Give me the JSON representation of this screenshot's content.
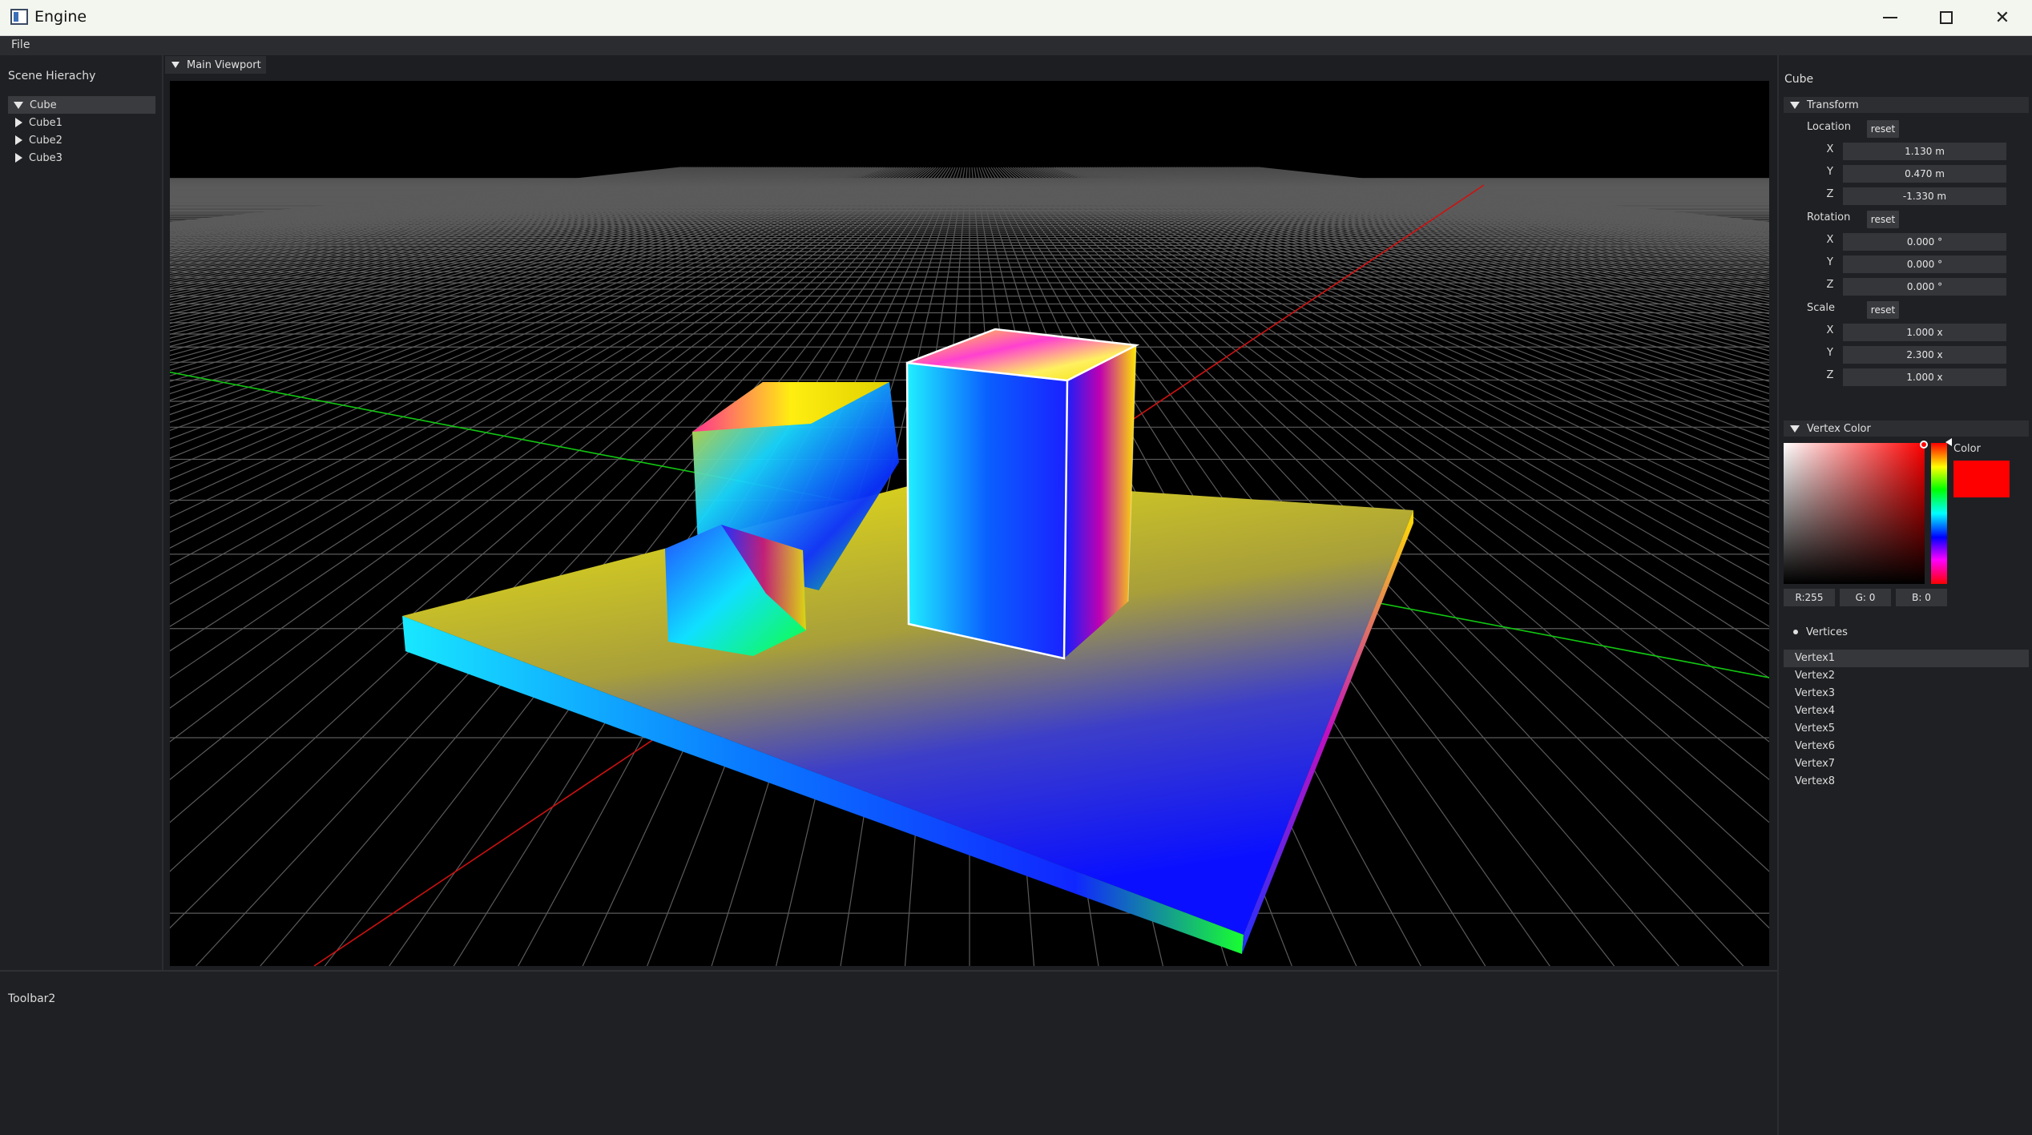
{
  "window": {
    "title": "Engine",
    "minimize_icon": "minimize-icon",
    "maximize_icon": "maximize-icon",
    "close_icon": "close-icon"
  },
  "menu": {
    "file": "File"
  },
  "hierarchy": {
    "title": "Scene Hierachy",
    "items": [
      {
        "label": "Cube",
        "expanded": true,
        "selected": true
      },
      {
        "label": "Cube1",
        "expanded": false,
        "selected": false
      },
      {
        "label": "Cube2",
        "expanded": false,
        "selected": false
      },
      {
        "label": "Cube3",
        "expanded": false,
        "selected": false
      }
    ]
  },
  "viewport": {
    "tab_label": "Main Viewport"
  },
  "toolbar2": {
    "title": "Toolbar2"
  },
  "inspector": {
    "object_name": "Cube",
    "transform": {
      "header": "Transform",
      "location": {
        "label": "Location",
        "reset": "reset",
        "x": "1.130 m",
        "y": "0.470 m",
        "z": "-1.330 m"
      },
      "rotation": {
        "label": "Rotation",
        "reset": "reset",
        "x": "0.000 °",
        "y": "0.000 °",
        "z": "0.000 °"
      },
      "scale": {
        "label": "Scale",
        "reset": "reset",
        "x": "1.000 x",
        "y": "2.300 x",
        "z": "1.000 x"
      },
      "axes": {
        "x": "X",
        "y": "Y",
        "z": "Z"
      }
    },
    "vertex_color": {
      "header": "Vertex Color",
      "color_label": "Color",
      "color_hex": "#ff0000",
      "r": "R:255",
      "g": "G:  0",
      "b": "B:  0"
    },
    "vertices": {
      "header": "Vertices",
      "items": [
        "Vertex1",
        "Vertex2",
        "Vertex3",
        "Vertex4",
        "Vertex5",
        "Vertex6",
        "Vertex7",
        "Vertex8"
      ],
      "selected_index": 0
    }
  }
}
